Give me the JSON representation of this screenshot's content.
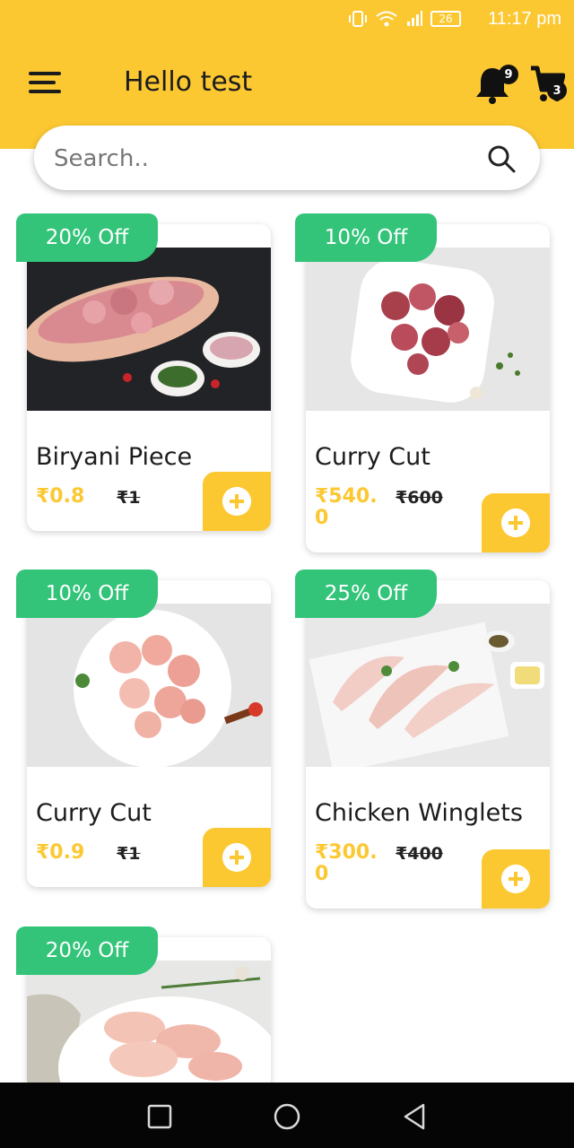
{
  "status": {
    "time": "11:17 pm",
    "battery": "26"
  },
  "header": {
    "title": "Hello test",
    "notification_count": "9",
    "cart_count": "3"
  },
  "search": {
    "placeholder": "Search.."
  },
  "products": [
    {
      "discount": "20% Off",
      "name": "Biryani Piece",
      "price": "₹0.8",
      "mrp": "₹1"
    },
    {
      "discount": "10% Off",
      "name": "Curry Cut",
      "price": "₹540.0",
      "mrp": "₹600"
    },
    {
      "discount": "10% Off",
      "name": "Curry Cut",
      "price": "₹0.9",
      "mrp": "₹1"
    },
    {
      "discount": "25% Off",
      "name": "Chicken Winglets",
      "price": "₹300.0",
      "mrp": "₹400"
    },
    {
      "discount": "20% Off"
    }
  ],
  "colors": {
    "accent": "#fcc832",
    "discount": "#33c47a"
  }
}
